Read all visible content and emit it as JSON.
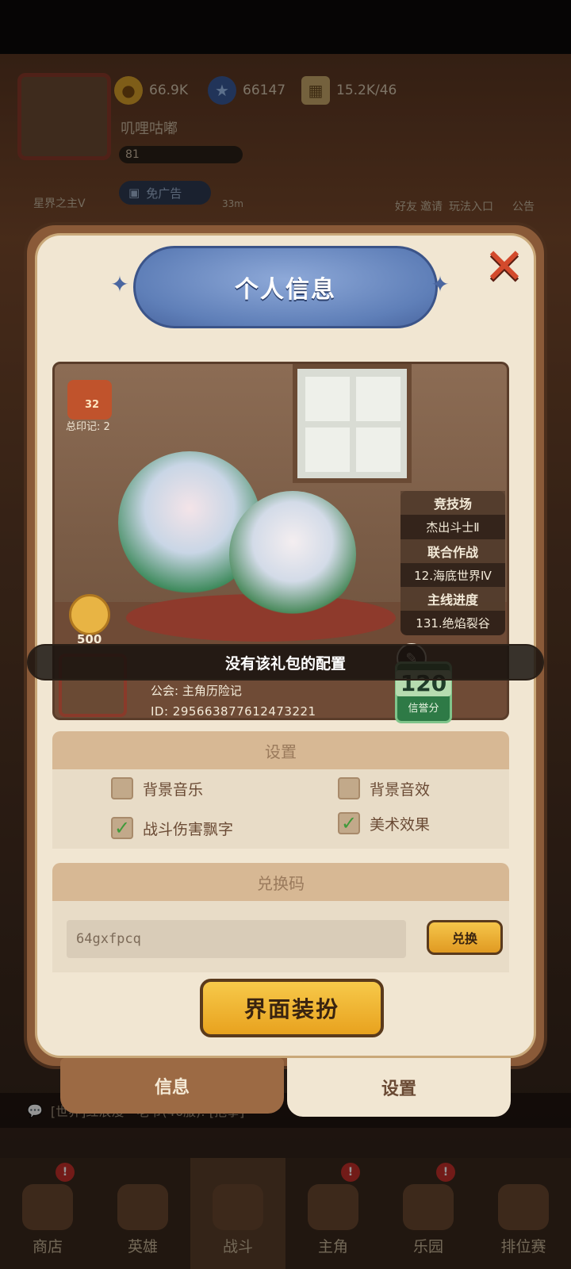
{
  "top_bar": {
    "coins": "66.9K",
    "stars": "66147",
    "cards": "15.2K/46",
    "player_name": "叽哩咕嘟",
    "level": "81",
    "title_badge": "星界之主V",
    "ad_label": "免广告",
    "timer": "33m",
    "friend_label": "好友",
    "invite_label": "邀请",
    "guide_label": "玩法入口",
    "notice_label": "公告"
  },
  "modal": {
    "title": "个人信息",
    "profile": {
      "total_marks_label": "总印记: 2",
      "mark_level": "32",
      "likes": "500",
      "name": "叽哩咕嘟",
      "guild": "公会: 主角历险记",
      "id": "ID: 295663877612473221",
      "credit_score": "120",
      "credit_label": "信誉分",
      "stats": [
        {
          "label": "竞技场",
          "value": "杰出斗士Ⅱ"
        },
        {
          "label": "联合作战",
          "value": "12.海底世界Ⅳ"
        },
        {
          "label": "主线进度",
          "value": "131.绝焰裂谷"
        }
      ]
    },
    "toast": "没有该礼包的配置",
    "settings": {
      "header": "设置",
      "options": [
        {
          "label": "背景音乐",
          "checked": false
        },
        {
          "label": "背景音效",
          "checked": false
        },
        {
          "label": "战斗伤害飘字",
          "checked": true
        },
        {
          "label": "美术效果",
          "checked": true
        }
      ]
    },
    "redeem": {
      "header": "兑换码",
      "code_value": "64gxfpcq",
      "button": "兑换"
    },
    "skin_button": "界面装扮",
    "tabs": {
      "info": "信息",
      "settings": "设置"
    }
  },
  "chat": {
    "message": "[世界]红浪漫丶老爷(46服): [抱拳]"
  },
  "bottom_nav": [
    {
      "label": "商店"
    },
    {
      "label": "英雄"
    },
    {
      "label": "战斗"
    },
    {
      "label": "主角"
    },
    {
      "label": "乐园"
    },
    {
      "label": "排位赛"
    }
  ],
  "colors": {
    "accent_gold": "#e8a21e",
    "title_blue": "#5f7fb8",
    "close_red": "#d34a2c",
    "check_green": "#3f9a3a"
  }
}
